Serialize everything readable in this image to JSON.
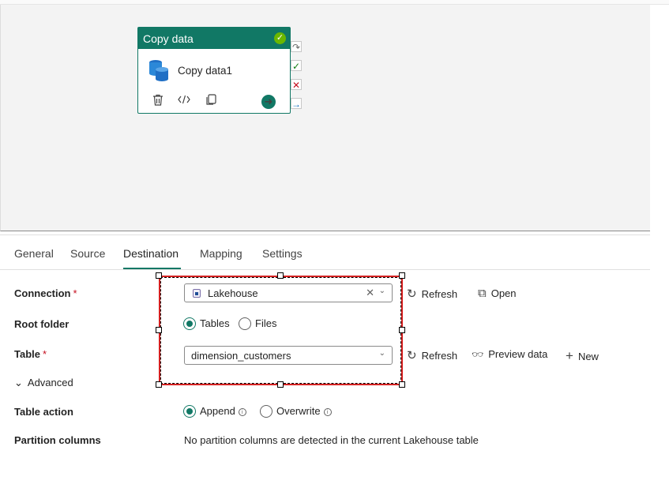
{
  "activity": {
    "header": "Copy data",
    "name": "Copy data1",
    "icons": [
      "delete-icon",
      "code-icon",
      "copy-icon",
      "arrow-right-icon"
    ],
    "status_color": "#6bb700",
    "accent_color": "#117865"
  },
  "tabs": [
    {
      "label": "General"
    },
    {
      "label": "Source"
    },
    {
      "label": "Destination"
    },
    {
      "label": "Mapping"
    },
    {
      "label": "Settings"
    }
  ],
  "active_tab": "Destination",
  "form": {
    "connection": {
      "label": "Connection",
      "required": "*",
      "value": "Lakehouse",
      "refresh_label": "Refresh",
      "open_label": "Open"
    },
    "root_folder": {
      "label": "Root folder",
      "options": [
        "Tables",
        "Files"
      ],
      "selected": "Tables"
    },
    "table": {
      "label": "Table",
      "required": "*",
      "value": "dimension_customers",
      "refresh_label": "Refresh",
      "preview_label": "Preview data",
      "new_label": "New"
    },
    "advanced_label": "Advanced",
    "table_action": {
      "label": "Table action",
      "options": [
        "Append",
        "Overwrite"
      ],
      "selected": "Append"
    },
    "partition_columns": {
      "label": "Partition columns",
      "message": "No partition columns are detected in the current Lakehouse table"
    }
  }
}
